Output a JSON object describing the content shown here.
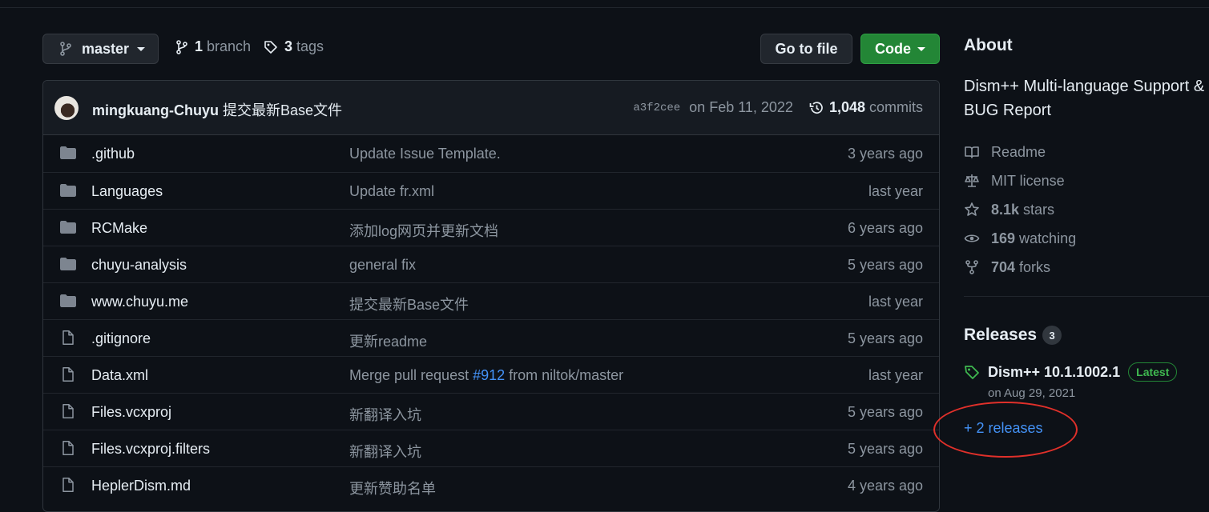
{
  "toolbar": {
    "branch_label": "master",
    "branch_count": "1",
    "branch_word": "branch",
    "tag_count": "3",
    "tag_word": "tags",
    "goto_file": "Go to file",
    "code": "Code"
  },
  "commit": {
    "author": "mingkuang-Chuyu",
    "message": "提交最新Base文件",
    "sha": "a3f2cee",
    "date": "on Feb 11, 2022",
    "count": "1,048",
    "count_word": "commits"
  },
  "files": [
    {
      "type": "dir",
      "name": ".github",
      "message": "Update Issue Template.",
      "age": "3 years ago"
    },
    {
      "type": "dir",
      "name": "Languages",
      "message": "Update fr.xml",
      "age": "last year"
    },
    {
      "type": "dir",
      "name": "RCMake",
      "message": "添加log网页并更新文档",
      "age": "6 years ago"
    },
    {
      "type": "dir",
      "name": "chuyu-analysis",
      "message": "general fix",
      "age": "5 years ago"
    },
    {
      "type": "dir",
      "name": "www.chuyu.me",
      "message": "提交最新Base文件",
      "age": "last year"
    },
    {
      "type": "file",
      "name": ".gitignore",
      "message": "更新readme",
      "age": "5 years ago"
    },
    {
      "type": "file",
      "name": "Data.xml",
      "message": "Merge pull request ",
      "pr": "#912",
      "message_after": " from niltok/master",
      "age": "last year"
    },
    {
      "type": "file",
      "name": "Files.vcxproj",
      "message": "新翻译入坑",
      "age": "5 years ago"
    },
    {
      "type": "file",
      "name": "Files.vcxproj.filters",
      "message": "新翻译入坑",
      "age": "5 years ago"
    },
    {
      "type": "file",
      "name": "HeplerDism.md",
      "message": "更新赞助名单",
      "age": "4 years ago"
    }
  ],
  "about": {
    "heading": "About",
    "description": "Dism++ Multi-language Support & BUG Report",
    "readme": "Readme",
    "license": "MIT license",
    "stars_count": "8.1k",
    "stars_word": "stars",
    "watching_count": "169",
    "watching_word": "watching",
    "forks_count": "704",
    "forks_word": "forks"
  },
  "releases": {
    "heading": "Releases",
    "count": "3",
    "latest_name": "Dism++ 10.1.1002.1",
    "latest_badge": "Latest",
    "latest_date": "on Aug 29, 2021",
    "more": "+ 2 releases"
  },
  "colors": {
    "background": "#0d1117",
    "code_button": "#238636",
    "link": "#4493f8",
    "annotation_circle": "#e0302a"
  }
}
